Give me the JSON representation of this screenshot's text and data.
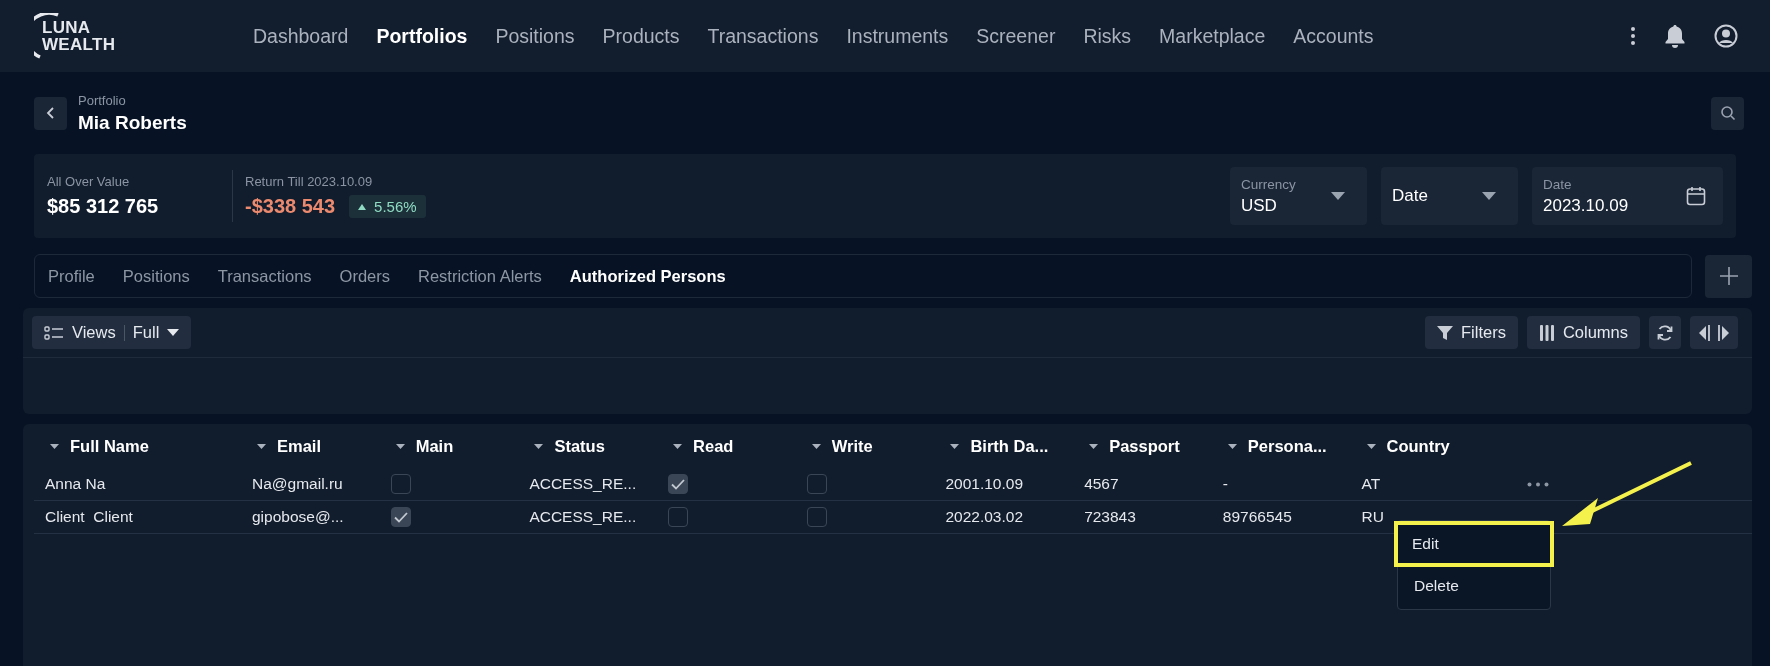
{
  "header": {
    "logo": "LUNA WEALTH",
    "nav": [
      {
        "label": "Dashboard",
        "selected": false
      },
      {
        "label": "Portfolios",
        "selected": true
      },
      {
        "label": "Positions",
        "selected": false
      },
      {
        "label": "Products",
        "selected": false
      },
      {
        "label": "Transactions",
        "selected": false
      },
      {
        "label": "Instruments",
        "selected": false
      },
      {
        "label": "Screener",
        "selected": false
      },
      {
        "label": "Risks",
        "selected": false
      },
      {
        "label": "Marketplace",
        "selected": false
      },
      {
        "label": "Accounts",
        "selected": false
      }
    ]
  },
  "portfolio": {
    "label": "Portfolio",
    "name": "Mia Roberts"
  },
  "summary": {
    "total": {
      "label": "All Over Value",
      "value": "$85 312 765"
    },
    "return": {
      "label": "Return Till 2023.10.09",
      "value": "-$338 543",
      "change": "5.56%"
    }
  },
  "filters": [
    {
      "kind": "select",
      "label": "Currency",
      "value": "USD"
    },
    {
      "kind": "select",
      "value": "Date"
    },
    {
      "kind": "date",
      "label": "Date",
      "value": "2023.10.09"
    }
  ],
  "tabs": [
    {
      "label": "Profile",
      "selected": false
    },
    {
      "label": "Positions",
      "selected": false
    },
    {
      "label": "Transactions",
      "selected": false
    },
    {
      "label": "Orders",
      "selected": false
    },
    {
      "label": "Restriction Alerts",
      "selected": false
    },
    {
      "label": "Authorized Persons",
      "selected": true
    }
  ],
  "toolbar": {
    "views": {
      "label": "Views",
      "value": "Full"
    },
    "buttons": [
      {
        "kind": "filters",
        "label": "Filters"
      },
      {
        "kind": "columns",
        "label": "Columns"
      },
      {
        "kind": "refresh"
      },
      {
        "kind": "toggle"
      }
    ]
  },
  "table": {
    "columns": [
      {
        "label": "Full Name",
        "kind": "text"
      },
      {
        "label": "Email",
        "kind": "text"
      },
      {
        "label": "Main",
        "kind": "check"
      },
      {
        "label": "Status",
        "kind": "text"
      },
      {
        "label": "Read",
        "kind": "check"
      },
      {
        "label": "Write",
        "kind": "check"
      },
      {
        "label": "Birth Da...",
        "kind": "text"
      },
      {
        "label": "Passport",
        "kind": "text"
      },
      {
        "label": "Persona...",
        "kind": "text"
      },
      {
        "label": "Country",
        "kind": "text"
      }
    ],
    "rows": [
      {
        "show_actions": true,
        "cells": [
          "Anna Na",
          "Na@gmail.ru",
          false,
          "ACCESS_RE...",
          true,
          false,
          "2001.10.09",
          "4567",
          "-",
          "AT"
        ]
      },
      {
        "show_actions": false,
        "cells": [
          "Client  Client",
          "gipobose@...",
          true,
          "ACCESS_RE...",
          false,
          false,
          "2022.03.02",
          "723843",
          "89766545",
          "RU"
        ]
      }
    ],
    "row_menu": {
      "items": [
        {
          "label": "Edit",
          "highlighted": true
        },
        {
          "label": "Delete",
          "highlighted": false
        }
      ]
    }
  }
}
